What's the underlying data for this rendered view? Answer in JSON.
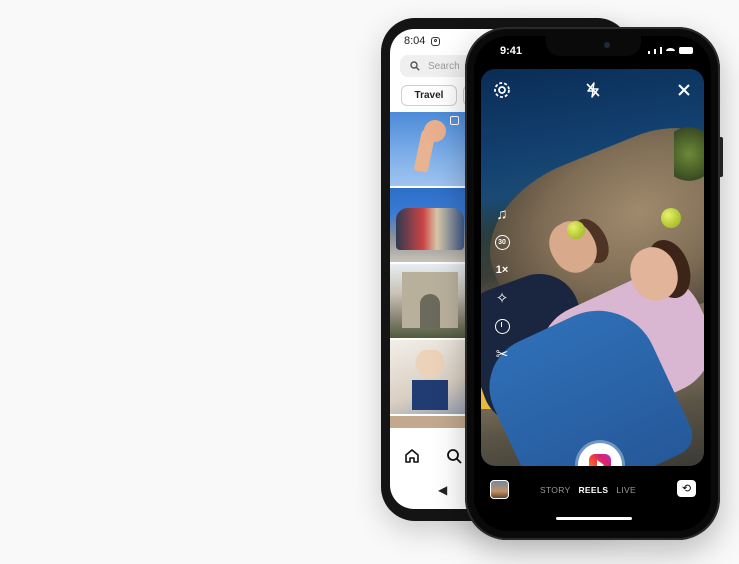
{
  "back_phone": {
    "status_time": "8:04",
    "search_placeholder": "Search",
    "chips": [
      "Travel",
      ""
    ],
    "icons": {
      "search": "search-icon",
      "home": "home-icon",
      "search_nav": "search-nav-icon",
      "back": "back-triangle-icon",
      "status_app": "instagram-icon"
    }
  },
  "front_phone": {
    "status_time": "9:41",
    "top_controls": {
      "settings": "settings-icon",
      "flash": "flash-off-icon",
      "close": "close-icon"
    },
    "tools": [
      {
        "name": "audio-icon",
        "glyph": "♫"
      },
      {
        "name": "length-icon",
        "glyph": "30"
      },
      {
        "name": "speed-icon",
        "glyph": "1×"
      },
      {
        "name": "effects-icon",
        "glyph": "✧"
      },
      {
        "name": "timer-icon",
        "glyph": ""
      },
      {
        "name": "align-icon",
        "glyph": "✂"
      }
    ],
    "modes": [
      {
        "label": "STORY",
        "active": false
      },
      {
        "label": "REELS",
        "active": true
      },
      {
        "label": "LIVE",
        "active": false
      }
    ],
    "colors": {
      "reels_gradient": [
        "#f9b233",
        "#f3512b",
        "#d8226f",
        "#b22fc4"
      ]
    }
  }
}
